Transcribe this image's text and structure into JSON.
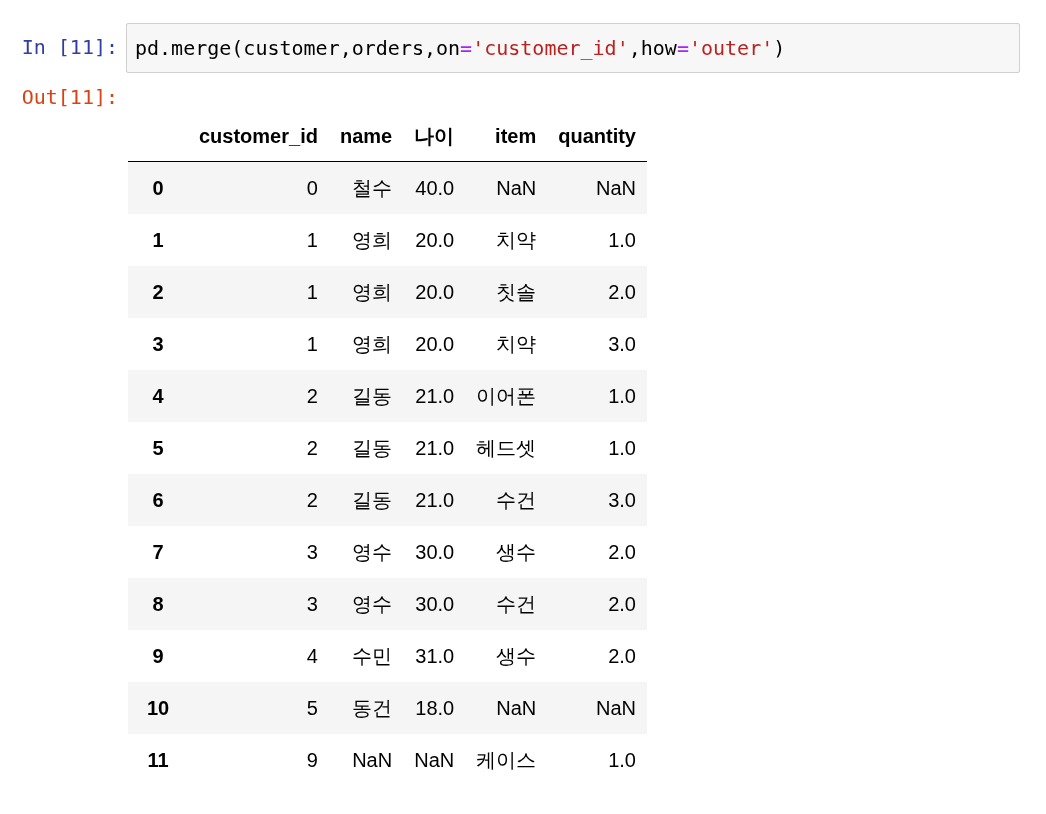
{
  "input_prompt": "In [11]:",
  "code_tokens": [
    {
      "text": "pd.merge(customer,orders,on",
      "kind": "name"
    },
    {
      "text": "=",
      "kind": "op"
    },
    {
      "text": "'customer_id'",
      "kind": "string"
    },
    {
      "text": ",how",
      "kind": "name"
    },
    {
      "text": "=",
      "kind": "op"
    },
    {
      "text": "'outer'",
      "kind": "string"
    },
    {
      "text": ")",
      "kind": "name"
    }
  ],
  "output_prompt": "Out[11]:",
  "table": {
    "columns": [
      "customer_id",
      "name",
      "나이",
      "item",
      "quantity"
    ],
    "rows": [
      {
        "index": "0",
        "cells": [
          "0",
          "철수",
          "40.0",
          "NaN",
          "NaN"
        ]
      },
      {
        "index": "1",
        "cells": [
          "1",
          "영희",
          "20.0",
          "치약",
          "1.0"
        ]
      },
      {
        "index": "2",
        "cells": [
          "1",
          "영희",
          "20.0",
          "칫솔",
          "2.0"
        ]
      },
      {
        "index": "3",
        "cells": [
          "1",
          "영희",
          "20.0",
          "치약",
          "3.0"
        ]
      },
      {
        "index": "4",
        "cells": [
          "2",
          "길동",
          "21.0",
          "이어폰",
          "1.0"
        ]
      },
      {
        "index": "5",
        "cells": [
          "2",
          "길동",
          "21.0",
          "헤드셋",
          "1.0"
        ]
      },
      {
        "index": "6",
        "cells": [
          "2",
          "길동",
          "21.0",
          "수건",
          "3.0"
        ]
      },
      {
        "index": "7",
        "cells": [
          "3",
          "영수",
          "30.0",
          "생수",
          "2.0"
        ]
      },
      {
        "index": "8",
        "cells": [
          "3",
          "영수",
          "30.0",
          "수건",
          "2.0"
        ]
      },
      {
        "index": "9",
        "cells": [
          "4",
          "수민",
          "31.0",
          "생수",
          "2.0"
        ]
      },
      {
        "index": "10",
        "cells": [
          "5",
          "동건",
          "18.0",
          "NaN",
          "NaN"
        ]
      },
      {
        "index": "11",
        "cells": [
          "9",
          "NaN",
          "NaN",
          "케이스",
          "1.0"
        ]
      }
    ]
  }
}
